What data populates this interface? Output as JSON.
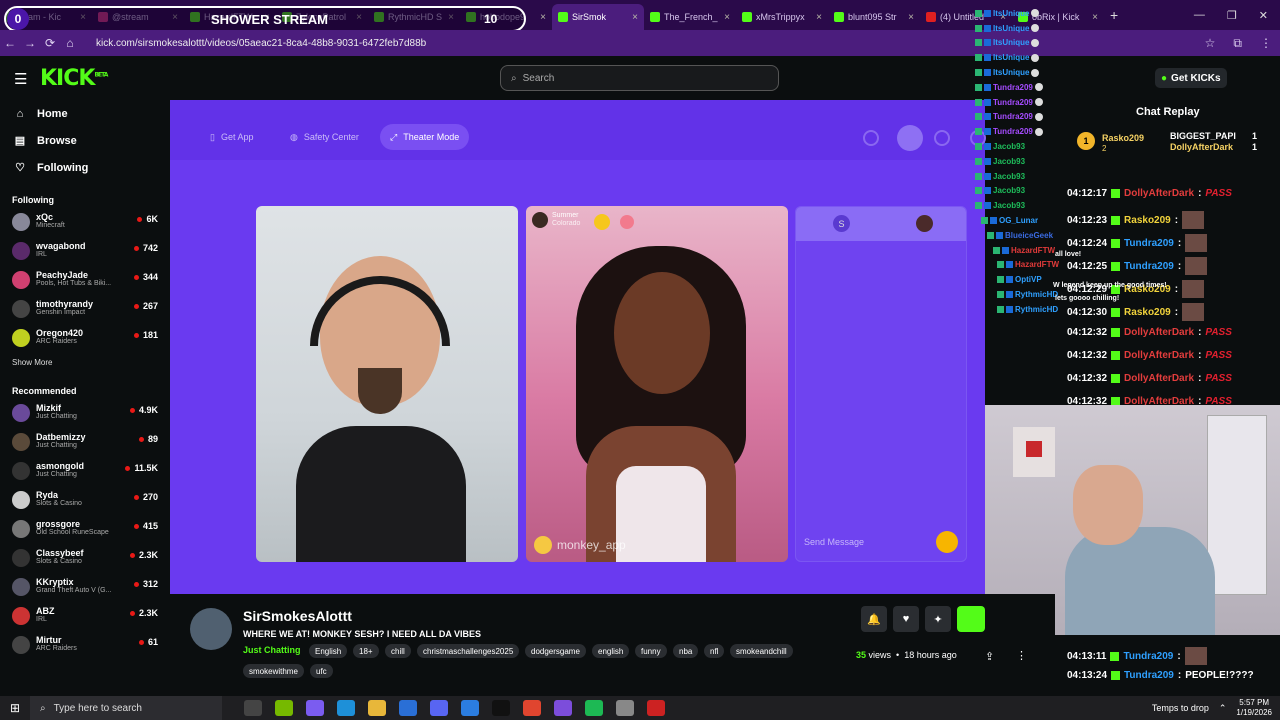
{
  "browser": {
    "tabs": [
      {
        "label": "ream - Kic",
        "active": false
      },
      {
        "label": "@stream",
        "active": false
      },
      {
        "label": "HazardFTW",
        "active": false
      },
      {
        "label": "ZylonyPatrol",
        "active": false
      },
      {
        "label": "RythmicHD S",
        "active": false
      },
      {
        "label": "hobodope9",
        "active": false
      },
      {
        "label": "SirSmok",
        "active": true
      },
      {
        "label": "The_French_",
        "active": false
      },
      {
        "label": "xMrsTrippyx",
        "active": false
      },
      {
        "label": "blunt095 Str",
        "active": false
      },
      {
        "label": "(4) Untitled",
        "active": false
      },
      {
        "label": "obRix | Kick",
        "active": false
      }
    ],
    "url": "kick.com/sirsmokesalottt/videos/05aeac21-8ca4-48b8-9031-6472feb7d88b"
  },
  "overlay": {
    "left_count": "0",
    "title": "SHOWER STREAM",
    "right_count": "10"
  },
  "site": {
    "logo": "KICK",
    "logo_beta": "BETA",
    "search_placeholder": "Search",
    "get_kicks": "Get KICKs"
  },
  "sidebar": {
    "nav": [
      {
        "label": "Home",
        "icon": "home-icon"
      },
      {
        "label": "Browse",
        "icon": "browse-icon"
      },
      {
        "label": "Following",
        "icon": "heart-icon"
      }
    ],
    "following_title": "Following",
    "following": [
      {
        "name": "xQc",
        "category": "Minecraft",
        "viewers": "6K"
      },
      {
        "name": "wvagabond",
        "category": "IRL",
        "viewers": "742"
      },
      {
        "name": "PeachyJade",
        "category": "Pools, Hot Tubs & Biki...",
        "viewers": "344"
      },
      {
        "name": "timothyrandy",
        "category": "Genshin Impact",
        "viewers": "267"
      },
      {
        "name": "Oregon420",
        "category": "ARC Raiders",
        "viewers": "181"
      }
    ],
    "show_more": "Show More",
    "recommended_title": "Recommended",
    "recommended": [
      {
        "name": "Mizkif",
        "category": "Just Chatting",
        "viewers": "4.9K"
      },
      {
        "name": "Datbemizzy",
        "category": "Just Chatting",
        "viewers": "89"
      },
      {
        "name": "asmongold",
        "category": "Just Chatting",
        "viewers": "11.5K"
      },
      {
        "name": "Ryda",
        "category": "Slots & Casino",
        "viewers": "270"
      },
      {
        "name": "grossgore",
        "category": "Old School RuneScape",
        "viewers": "415"
      },
      {
        "name": "Classybeef",
        "category": "Slots & Casino",
        "viewers": "2.3K"
      },
      {
        "name": "KKryptix",
        "category": "Grand Theft Auto V (G...",
        "viewers": "312"
      },
      {
        "name": "ABZ",
        "category": "IRL",
        "viewers": "2.3K"
      },
      {
        "name": "Mirtur",
        "category": "ARC Raiders",
        "viewers": "61"
      }
    ]
  },
  "player": {
    "get_app": "Get App",
    "safety_center": "Safety Center",
    "theater_mode": "Theater Mode",
    "summer_name": "Summer",
    "summer_loc": "Colorado",
    "watermark": "monkey_app",
    "f3_initial": "S",
    "send_message": "Send Message"
  },
  "chat_overlay": [
    {
      "name": "ItsUnique"
    },
    {
      "name": "ItsUnique"
    },
    {
      "name": "ItsUnique"
    },
    {
      "name": "ItsUnique"
    },
    {
      "name": "ItsUnique"
    },
    {
      "name": "Tundra209"
    },
    {
      "name": "Tundra209"
    },
    {
      "name": "Tundra209"
    },
    {
      "name": "Tundra209"
    },
    {
      "name": "Jacob93"
    },
    {
      "name": "Jacob93"
    },
    {
      "name": "Jacob93"
    },
    {
      "name": "Jacob93"
    },
    {
      "name": "Jacob93"
    },
    {
      "name": "OG_Lunar"
    },
    {
      "name": "BlueiceGeek"
    },
    {
      "name": "HazardFTW"
    },
    {
      "name": "HazardFTW"
    },
    {
      "name": "OptiVP"
    },
    {
      "name": "RythmicHD"
    },
    {
      "name": "RythmicHD"
    }
  ],
  "chat_replay": {
    "title": "Chat Replay",
    "gifter_rank": "1",
    "gifter_top": "Rasko209",
    "gifter_top_count": "2",
    "gifter_2": "BIGGEST_PAPI",
    "gifter_2_count": "1",
    "gifter_3": "DollyAfterDark",
    "gifter_3_count": "1",
    "messages": [
      {
        "time": "04:12:17",
        "user": "DollyAfterDark",
        "color": "#e33d3d",
        "text": "PASS",
        "type": "pass"
      },
      {
        "time": "04:12:23",
        "user": "Rasko209",
        "color": "#f2d43c",
        "text": "",
        "type": "emote"
      },
      {
        "time": "04:12:24",
        "user": "Tundra209",
        "color": "#2fa0ff",
        "text": "",
        "type": "emote"
      },
      {
        "time": "04:12:25",
        "user": "Tundra209",
        "color": "#2fa0ff",
        "text": "",
        "type": "emote"
      },
      {
        "time": "04:12:29",
        "user": "Rasko209",
        "color": "#f2d43c",
        "text": "",
        "type": "emote"
      },
      {
        "time": "04:12:30",
        "user": "Rasko209",
        "color": "#f2d43c",
        "text": "",
        "type": "emote"
      },
      {
        "time": "04:12:32",
        "user": "DollyAfterDark",
        "color": "#e33d3d",
        "text": "PASS",
        "type": "pass"
      },
      {
        "time": "04:12:32",
        "user": "DollyAfterDark",
        "color": "#e33d3d",
        "text": "PASS",
        "type": "pass"
      },
      {
        "time": "04:12:32",
        "user": "DollyAfterDark",
        "color": "#e33d3d",
        "text": "PASS",
        "type": "pass"
      },
      {
        "time": "04:12:32",
        "user": "DollyAfterDark",
        "color": "#e33d3d",
        "text": "PASS",
        "type": "pass"
      }
    ],
    "bottom_messages": [
      {
        "time": "04:13:11",
        "user": "Tundra209",
        "color": "#2fa0ff",
        "text": "",
        "type": "emote"
      },
      {
        "time": "04:13:24",
        "user": "Tundra209",
        "color": "#2fa0ff",
        "text": "PEOPLE!????",
        "type": "text"
      }
    ],
    "overlay_msgs": [
      "all love!",
      "W legend keep up the good times!",
      "lets goooo chilling!"
    ]
  },
  "stream": {
    "streamer": "SirSmokesAlottt",
    "title": "WHERE WE AT! MONKEY SESH? I NEED ALL DA VIBES",
    "category": "Just Chatting",
    "tags": [
      "English",
      "18+",
      "chill",
      "christmaschallenges2025",
      "dodgersgame",
      "english",
      "funny",
      "nba",
      "nfl",
      "smokeandchill",
      "smokewithme",
      "ufc"
    ],
    "views": "35",
    "views_label": "views",
    "age": "18 hours ago"
  },
  "taskbar": {
    "search": "Type here to search",
    "weather": "Temps to drop",
    "time": "5:57 PM",
    "date": "1/19/2026"
  }
}
